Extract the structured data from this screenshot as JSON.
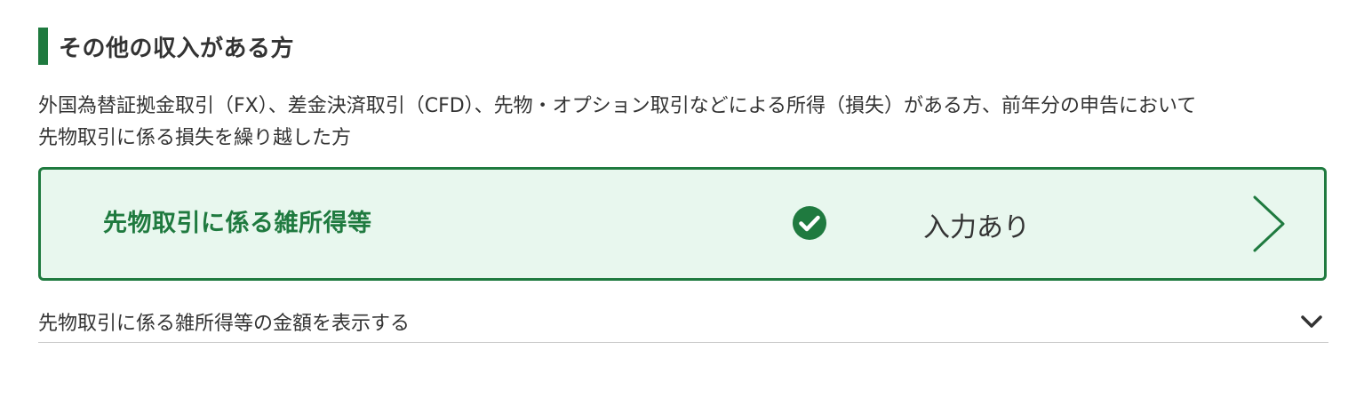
{
  "section": {
    "title": "その他の収入がある方",
    "description_lines": [
      "外国為替証拠金取引（FX）、差金決済取引（CFD）、先物・オプション取引などによる所得（損失）がある方、前年分の申告において",
      "先物取引に係る損失を繰り越した方"
    ]
  },
  "income_card": {
    "title": "先物取引に係る雑所得等",
    "status": "入力あり",
    "status_icon": "check-circle-icon",
    "action_icon": "chevron-right-icon"
  },
  "amount_toggle": {
    "label": "先物取引に係る雑所得等の金額を表示する",
    "icon": "chevron-down-icon"
  },
  "colors": {
    "accent": "#1f7a3f",
    "card_background": "#e8f7ee",
    "text": "#333333",
    "divider": "#cccccc"
  }
}
